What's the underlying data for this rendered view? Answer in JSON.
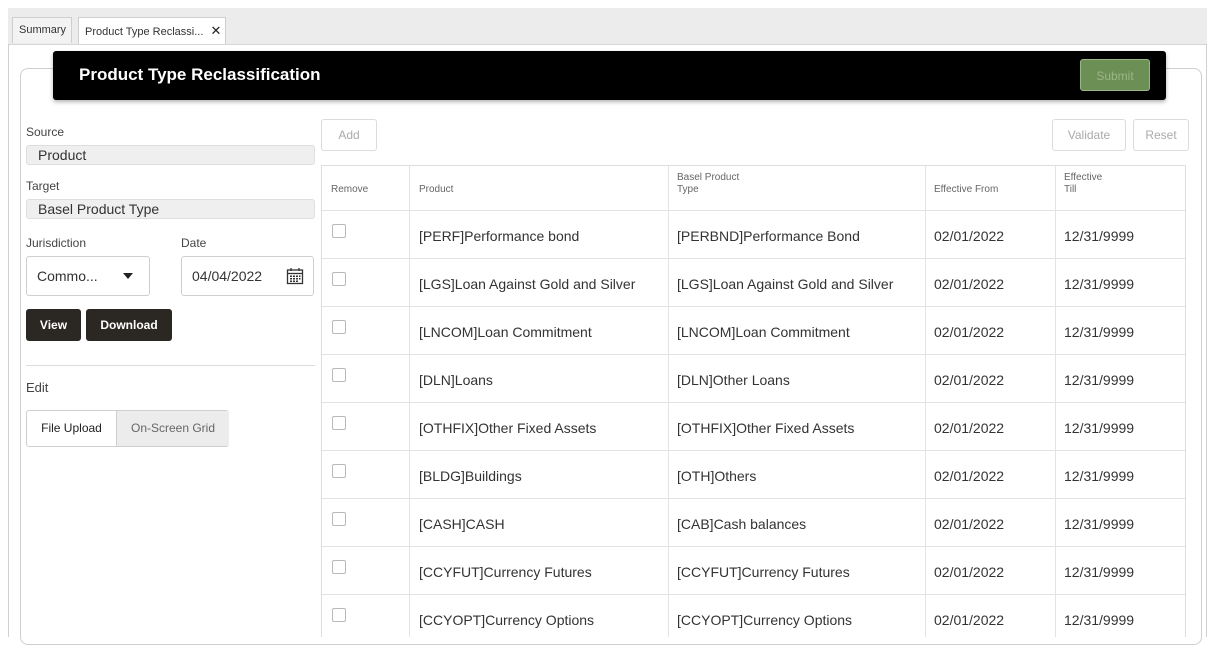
{
  "tabs": [
    {
      "label": "Summary"
    },
    {
      "label": "Product Type Reclassi...",
      "close": "✕"
    }
  ],
  "header": {
    "title": "Product Type Reclassification",
    "submit_label": "Submit"
  },
  "form": {
    "source_label": "Source",
    "source_value": "Product",
    "target_label": "Target",
    "target_value": "Basel Product Type",
    "jurisdiction_label": "Jurisdiction",
    "jurisdiction_value": "Commo...",
    "date_label": "Date",
    "date_value": "04/04/2022",
    "view_label": "View",
    "download_label": "Download",
    "edit_label": "Edit",
    "file_upload_label": "File Upload",
    "onscreen_grid_label": "On-Screen Grid"
  },
  "toolbar": {
    "add_label": "Add",
    "validate_label": "Validate",
    "reset_label": "Reset"
  },
  "table": {
    "columns": [
      "Remove",
      "Product",
      "Basel Product\nType",
      "Effective From",
      "Effective\nTill"
    ],
    "rows": [
      {
        "product": "[PERF]Performance bond",
        "basel": "[PERBND]Performance Bond",
        "from": "02/01/2022",
        "till": "12/31/9999"
      },
      {
        "product": "[LGS]Loan Against Gold and Silver",
        "basel": "[LGS]Loan Against Gold and Silver",
        "from": "02/01/2022",
        "till": "12/31/9999"
      },
      {
        "product": "[LNCOM]Loan Commitment",
        "basel": "[LNCOM]Loan Commitment",
        "from": "02/01/2022",
        "till": "12/31/9999"
      },
      {
        "product": "[DLN]Loans",
        "basel": "[DLN]Other Loans",
        "from": "02/01/2022",
        "till": "12/31/9999"
      },
      {
        "product": "[OTHFIX]Other Fixed Assets",
        "basel": "[OTHFIX]Other Fixed Assets",
        "from": "02/01/2022",
        "till": "12/31/9999"
      },
      {
        "product": "[BLDG]Buildings",
        "basel": "[OTH]Others",
        "from": "02/01/2022",
        "till": "12/31/9999"
      },
      {
        "product": "[CASH]CASH",
        "basel": "[CAB]Cash balances",
        "from": "02/01/2022",
        "till": "12/31/9999"
      },
      {
        "product": "[CCYFUT]Currency Futures",
        "basel": "[CCYFUT]Currency Futures",
        "from": "02/01/2022",
        "till": "12/31/9999"
      },
      {
        "product": "[CCYOPT]Currency Options",
        "basel": "[CCYOPT]Currency Options",
        "from": "02/01/2022",
        "till": "12/31/9999"
      }
    ]
  },
  "icons": {
    "calendar": "calendar-icon",
    "dropdown": "caret-down-icon",
    "close": "close-icon"
  },
  "colors": {
    "titlebar": "#000000",
    "submit": "#6b8f55",
    "dark_button": "#2b2722"
  }
}
